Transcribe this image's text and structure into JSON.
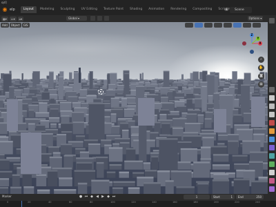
{
  "app": {
    "file_label": "ojd]",
    "help_menu": "elp",
    "workspaces": [
      {
        "label": "Layout",
        "active": true
      },
      {
        "label": "Modeling",
        "active": false
      },
      {
        "label": "Sculpting",
        "active": false
      },
      {
        "label": "UV Editing",
        "active": false
      },
      {
        "label": "Texture Paint",
        "active": false
      },
      {
        "label": "Shading",
        "active": false
      },
      {
        "label": "Animation",
        "active": false
      },
      {
        "label": "Rendering",
        "active": false
      },
      {
        "label": "Compositing",
        "active": false
      },
      {
        "label": "Scripting",
        "active": false
      }
    ],
    "add_workspace": "+",
    "scene": "Scene"
  },
  "header": {
    "transform_orientation": "Global",
    "options_label": "Options"
  },
  "viewport_menu": {
    "add": "Add",
    "object": "Object",
    "gis": "GIS"
  },
  "gizmo": {
    "x": "X",
    "y": "Y",
    "z": "Z",
    "colors": {
      "x": "#e0404f",
      "y": "#7fc92a",
      "z": "#4f8de0"
    }
  },
  "timeline": {
    "marker_label": "Marker",
    "current_frame": "1",
    "start_label": "Start",
    "start": "1",
    "end_label": "End",
    "end": "250",
    "ruler_ticks": [
      "0",
      "20",
      "40",
      "60",
      "80",
      "100",
      "120",
      "140",
      "160",
      "180",
      "200",
      "220",
      "240"
    ]
  },
  "colors": {
    "accent": "#4772b3",
    "app_orange": "#e87d0d"
  }
}
